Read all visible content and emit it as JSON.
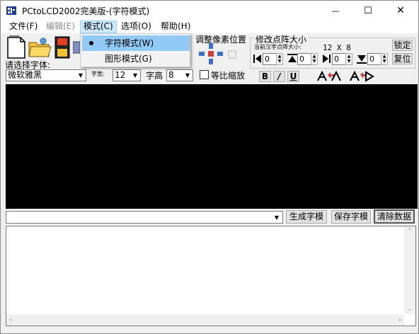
{
  "window": {
    "title": "PCtoLCD2002完美版-(字符模式)",
    "minimize": "—",
    "maximize": "☐",
    "close": "✕"
  },
  "menu": {
    "items": [
      {
        "label": "文件(F)"
      },
      {
        "label": "编辑(E)"
      },
      {
        "label": "模式(C)"
      },
      {
        "label": "选项(O)"
      },
      {
        "label": "帮助(H)"
      }
    ],
    "dropdown": [
      {
        "label": "字符模式(W)",
        "selected": true
      },
      {
        "label": "图形模式(G)",
        "selected": false
      }
    ]
  },
  "toolbar": {
    "font_select_label": "请选择字体:",
    "font_name": "微软雅黑",
    "char_width_label": "字宽:",
    "char_width": "12",
    "char_height_label": "字高",
    "char_height": "8",
    "proportional_label": "等比缩放",
    "adjust_pixel_label": "调整像素位置",
    "resize_group_label": "修改点阵大小",
    "current_size_label": "当前汉字点阵大小:",
    "current_size_value": "12  X  8",
    "spin_values": [
      "0",
      "0",
      "0",
      "0"
    ],
    "lock_label": "锁定",
    "restore_label": "复位",
    "bold": "B",
    "italic": "/",
    "underline": "U"
  },
  "bottom": {
    "generate_label": "生成字模",
    "save_label": "保存字模",
    "clear_label": "清除数据"
  },
  "colors": {
    "canvas": "#000000",
    "menu_highlight": "#cce8ff",
    "dropdown_highlight": "#91c9f7"
  }
}
